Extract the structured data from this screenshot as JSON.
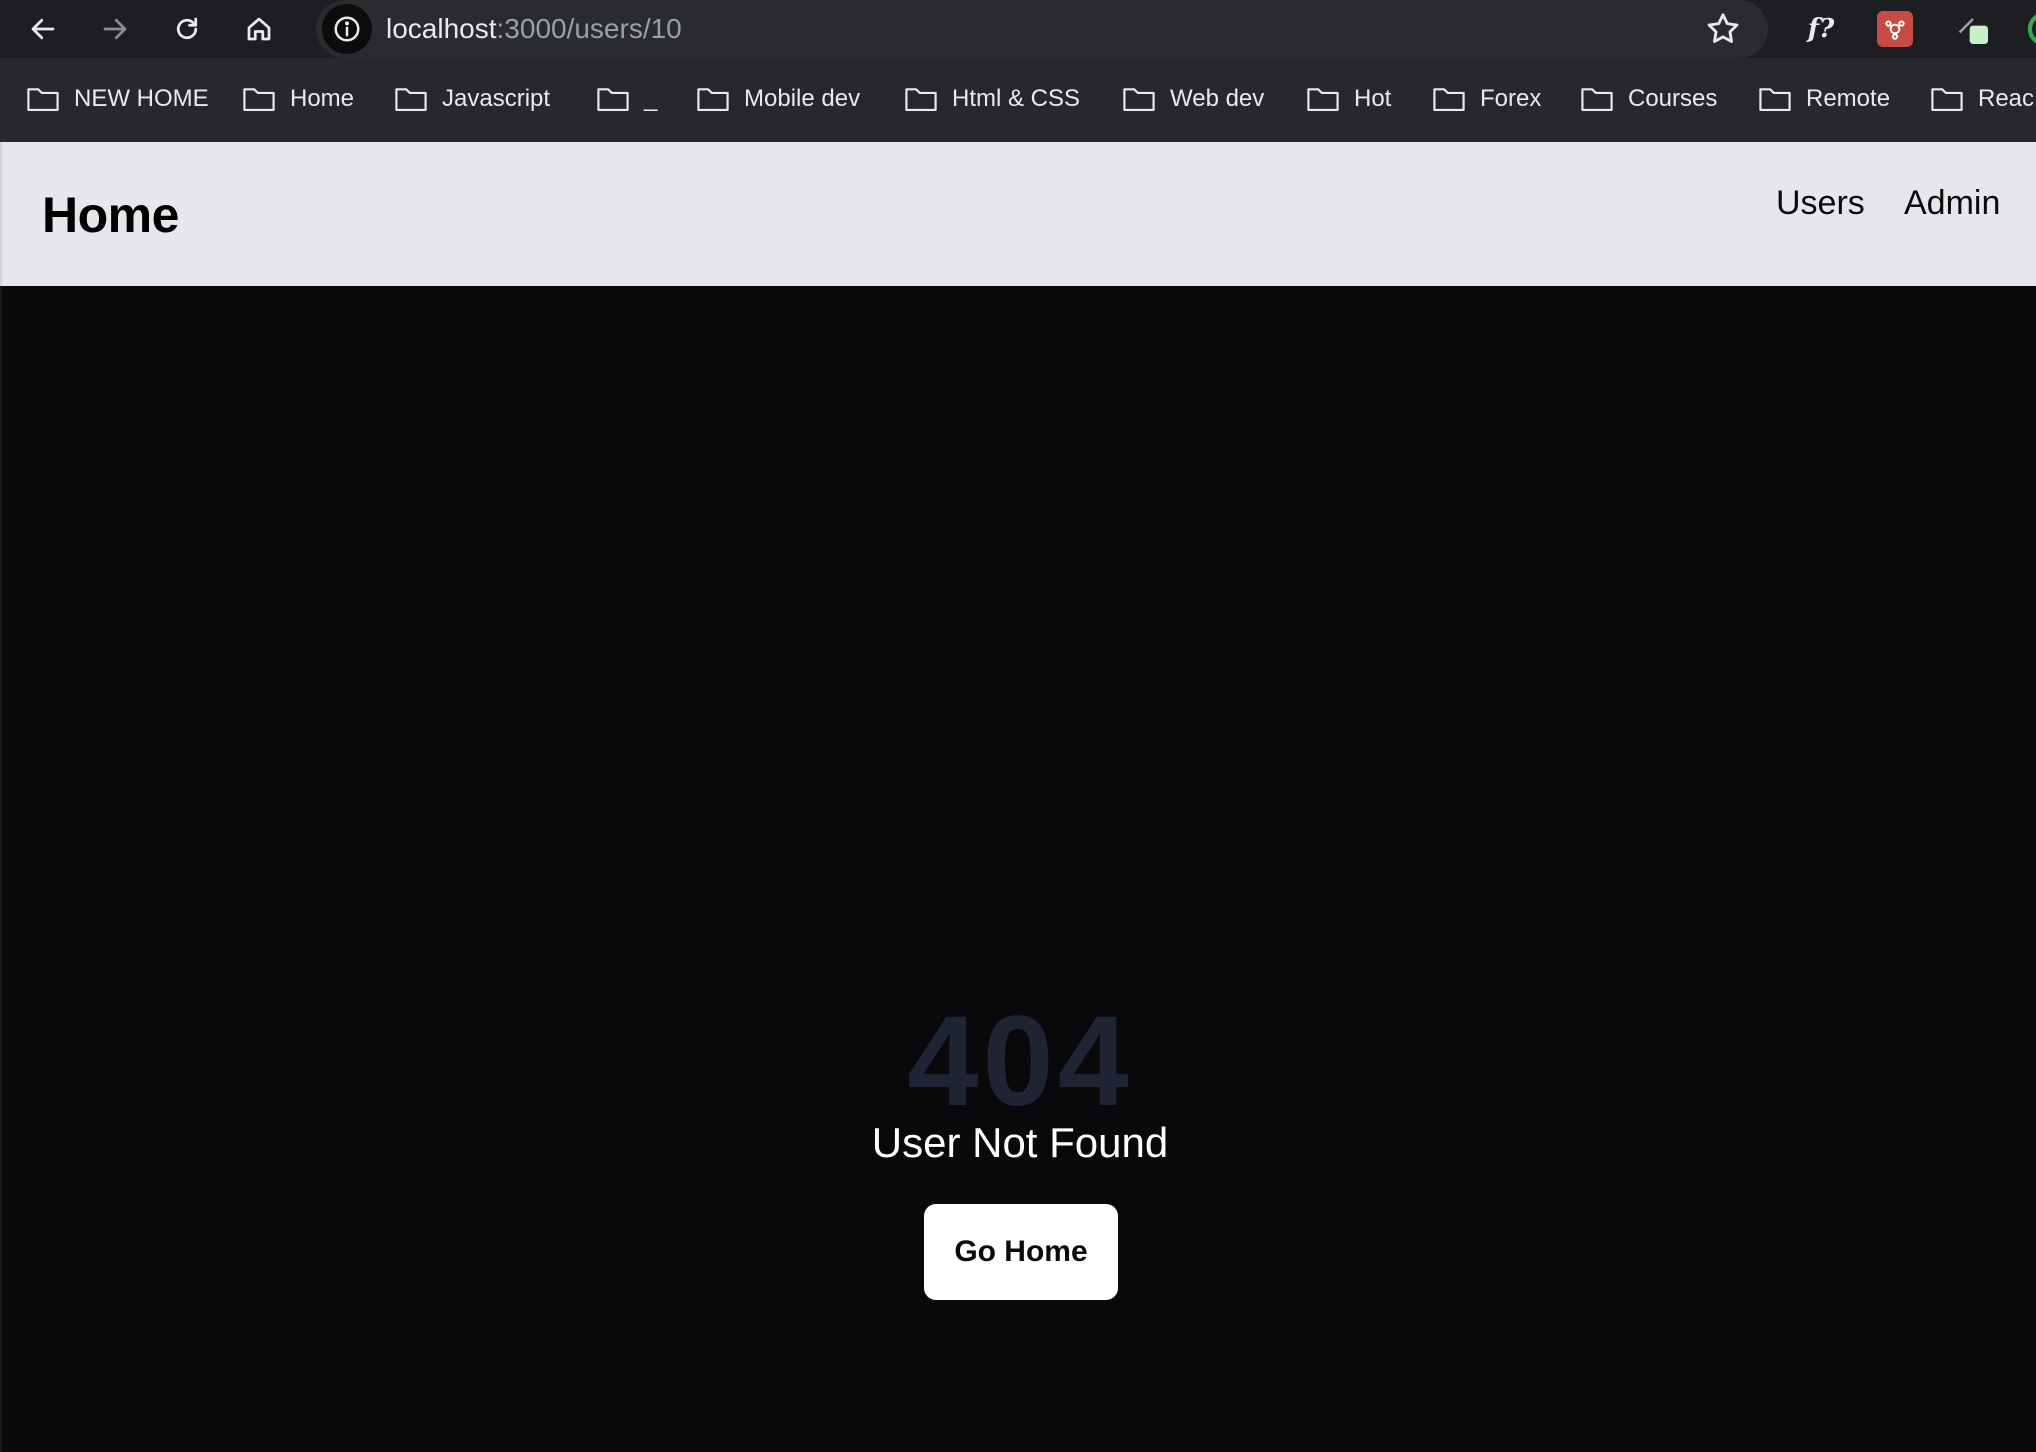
{
  "browser": {
    "url_host": "localhost",
    "url_rest": ":3000/users/10",
    "extensions": {
      "fx_label": "f?"
    },
    "icons": [
      "back-arrow-icon",
      "forward-arrow-icon",
      "reload-icon",
      "home-icon",
      "site-info-icon",
      "star-icon",
      "folder-icon"
    ],
    "bookmarks": [
      "NEW HOME",
      "Home",
      "Javascript",
      "_",
      "Mobile dev",
      "Html & CSS",
      "Web dev",
      "Hot",
      "Forex",
      "Courses",
      "Remote",
      "Reac"
    ]
  },
  "navbar": {
    "brand": "Home",
    "links": [
      "Users",
      "Admin"
    ]
  },
  "main": {
    "code": "404",
    "message": "User Not Found",
    "button_label": "Go Home"
  },
  "colors": {
    "page_bg": "#09090b",
    "navbar_bg": "#e5e7eb",
    "code_color": "#1e2433",
    "button_bg": "#ffffff"
  }
}
